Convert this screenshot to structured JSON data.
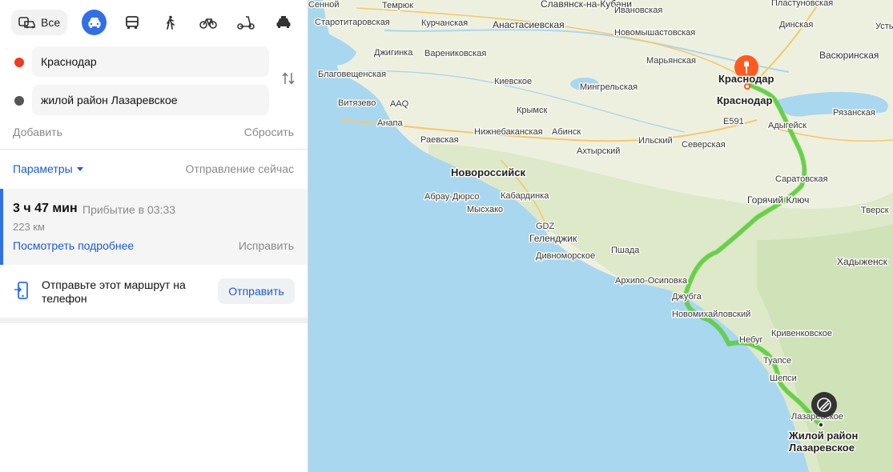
{
  "modes": {
    "all_label": "Все",
    "items": [
      "car",
      "bus",
      "walk",
      "bike",
      "scooter",
      "taxi"
    ],
    "active": "car"
  },
  "route": {
    "from": "Краснодар",
    "to": "жилой район Лазаревское",
    "add_label": "Добавить",
    "reset_label": "Сбросить"
  },
  "params": {
    "label": "Параметры",
    "departure": "Отправление сейчас"
  },
  "summary": {
    "duration": "3 ч 47 мин",
    "arrival": "Прибытие в 03:33",
    "distance": "223 км",
    "details_label": "Посмотреть подробнее",
    "fix_label": "Исправить"
  },
  "send": {
    "text": "Отправьте этот маршрут на телефон",
    "button": "Отправить"
  },
  "map": {
    "labels": [
      "Сенной",
      "Темрюк",
      "Славянск-на-Кубани",
      "Ивановская",
      "Пластуновская",
      "Старотитаровская",
      "Курчанская",
      "Анастасиевская",
      "Новомышастовская",
      "Динская",
      "Усть-",
      "Джигинка",
      "Варениковская",
      "Марьянская",
      "Васюринская",
      "Благовещенская",
      "Киевское",
      "Мингрельская",
      "Витязево",
      "AAQ",
      "Крымск",
      "Анапа",
      "E591",
      "Рязанская",
      "Адыгейск",
      "Нижнебаканская",
      "Абинск",
      "Раевская",
      "Ильский",
      "Северская",
      "Ахтырский",
      "Новороссийск",
      "Саратовская",
      "Кабардинка",
      "Абрау-Дюрсо",
      "Горячий Ключ",
      "Мысхако",
      "Тверск",
      "GDZ",
      "Геленджик",
      "Пшада",
      "Дивноморское",
      "Хадыженск",
      "Архипо-Осиповка",
      "Джубга",
      "Новомихайловский",
      "Кривенковское",
      "Небуг",
      "Туапсе",
      "Шепси",
      "Лазаревское"
    ],
    "start_label": "Краснодар",
    "end_label": "Жилой район Лазаревское",
    "colors": {
      "sea": "#a9d7ef",
      "land": "#eef0df",
      "route": "#5ed63c",
      "start_pin": "#ff5a1f"
    }
  }
}
